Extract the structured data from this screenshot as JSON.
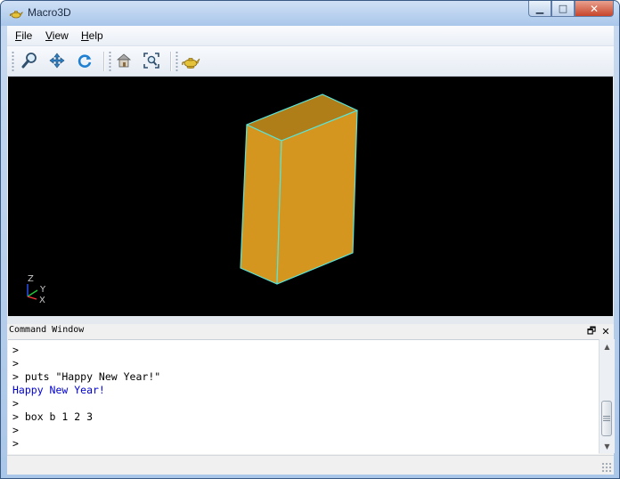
{
  "window": {
    "title": "Macro3D",
    "minimize_glyph": "▁",
    "maximize_glyph": "□",
    "close_glyph": "✕"
  },
  "menu": {
    "items": [
      {
        "mnemonic": "F",
        "rest": "ile"
      },
      {
        "mnemonic": "V",
        "rest": "iew"
      },
      {
        "mnemonic": "H",
        "rest": "elp"
      }
    ]
  },
  "toolbar": {
    "buttons": [
      "zoom-icon",
      "pan-icon",
      "rotate-icon",
      "home-view-icon",
      "fit-all-icon",
      "genie-lamp-icon"
    ]
  },
  "viewport": {
    "background": "#000000",
    "box_color": "#d4961e",
    "box_top_color": "#b07e18",
    "edge_color": "#58e6dc",
    "axes": {
      "z": "Z",
      "y": "Y",
      "x": "X"
    }
  },
  "command_window": {
    "title": "Command Window",
    "restore_glyph": "🗗",
    "close_glyph": "✕",
    "lines": [
      {
        "text": ">",
        "kind": "prompt"
      },
      {
        "text": ">",
        "kind": "prompt"
      },
      {
        "text": "> puts \"Happy New Year!\"",
        "kind": "prompt"
      },
      {
        "text": "Happy New Year!",
        "kind": "output",
        "color": "#0000d0"
      },
      {
        "text": ">",
        "kind": "prompt"
      },
      {
        "text": "> box b 1 2 3",
        "kind": "prompt"
      },
      {
        "text": ">",
        "kind": "prompt"
      },
      {
        "text": ">",
        "kind": "prompt"
      }
    ]
  }
}
